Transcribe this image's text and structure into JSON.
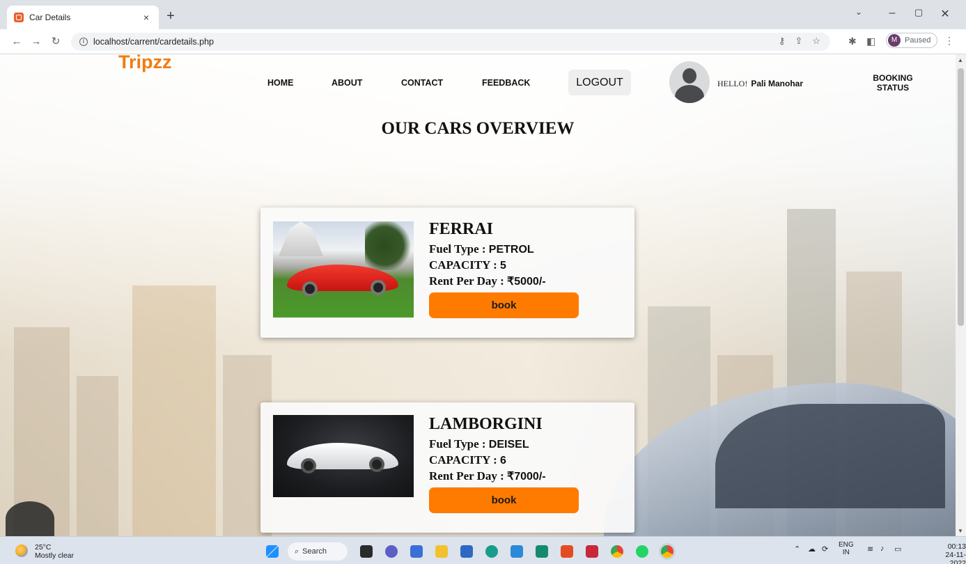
{
  "browser": {
    "tab_title": "Car Details",
    "url": "localhost/carrent/cardetails.php",
    "profile_initial": "M",
    "profile_status": "Paused"
  },
  "site": {
    "brand": "Tripzz",
    "nav": [
      "HOME",
      "ABOUT",
      "CONTACT",
      "FEEDBACK"
    ],
    "logout": "LOGOUT",
    "greeting": "HELLO!",
    "user_name": "Pali Manohar",
    "booking_status": "BOOKING STATUS"
  },
  "page": {
    "heading": "OUR CARS OVERVIEW"
  },
  "labels": {
    "fuel": "Fuel Type : ",
    "capacity": "CAPACITY : ",
    "rent": "Rent Per Day : "
  },
  "cars": [
    {
      "name": "FERRAI",
      "fuel": "PETROL",
      "capacity": "5",
      "rent": "₹5000/-",
      "button": "book"
    },
    {
      "name": "LAMBORGINI",
      "fuel": "DEISEL",
      "capacity": "6",
      "rent": "₹7000/-",
      "button": "book"
    }
  ],
  "taskbar": {
    "temperature": "25°C",
    "weather": "Mostly clear",
    "search": "Search",
    "lang_top": "ENG",
    "lang_bottom": "IN",
    "time": "00:13",
    "date": "24-11-2022"
  },
  "colors": {
    "brand_orange": "#f07c11",
    "button_orange": "#ff7b00"
  }
}
